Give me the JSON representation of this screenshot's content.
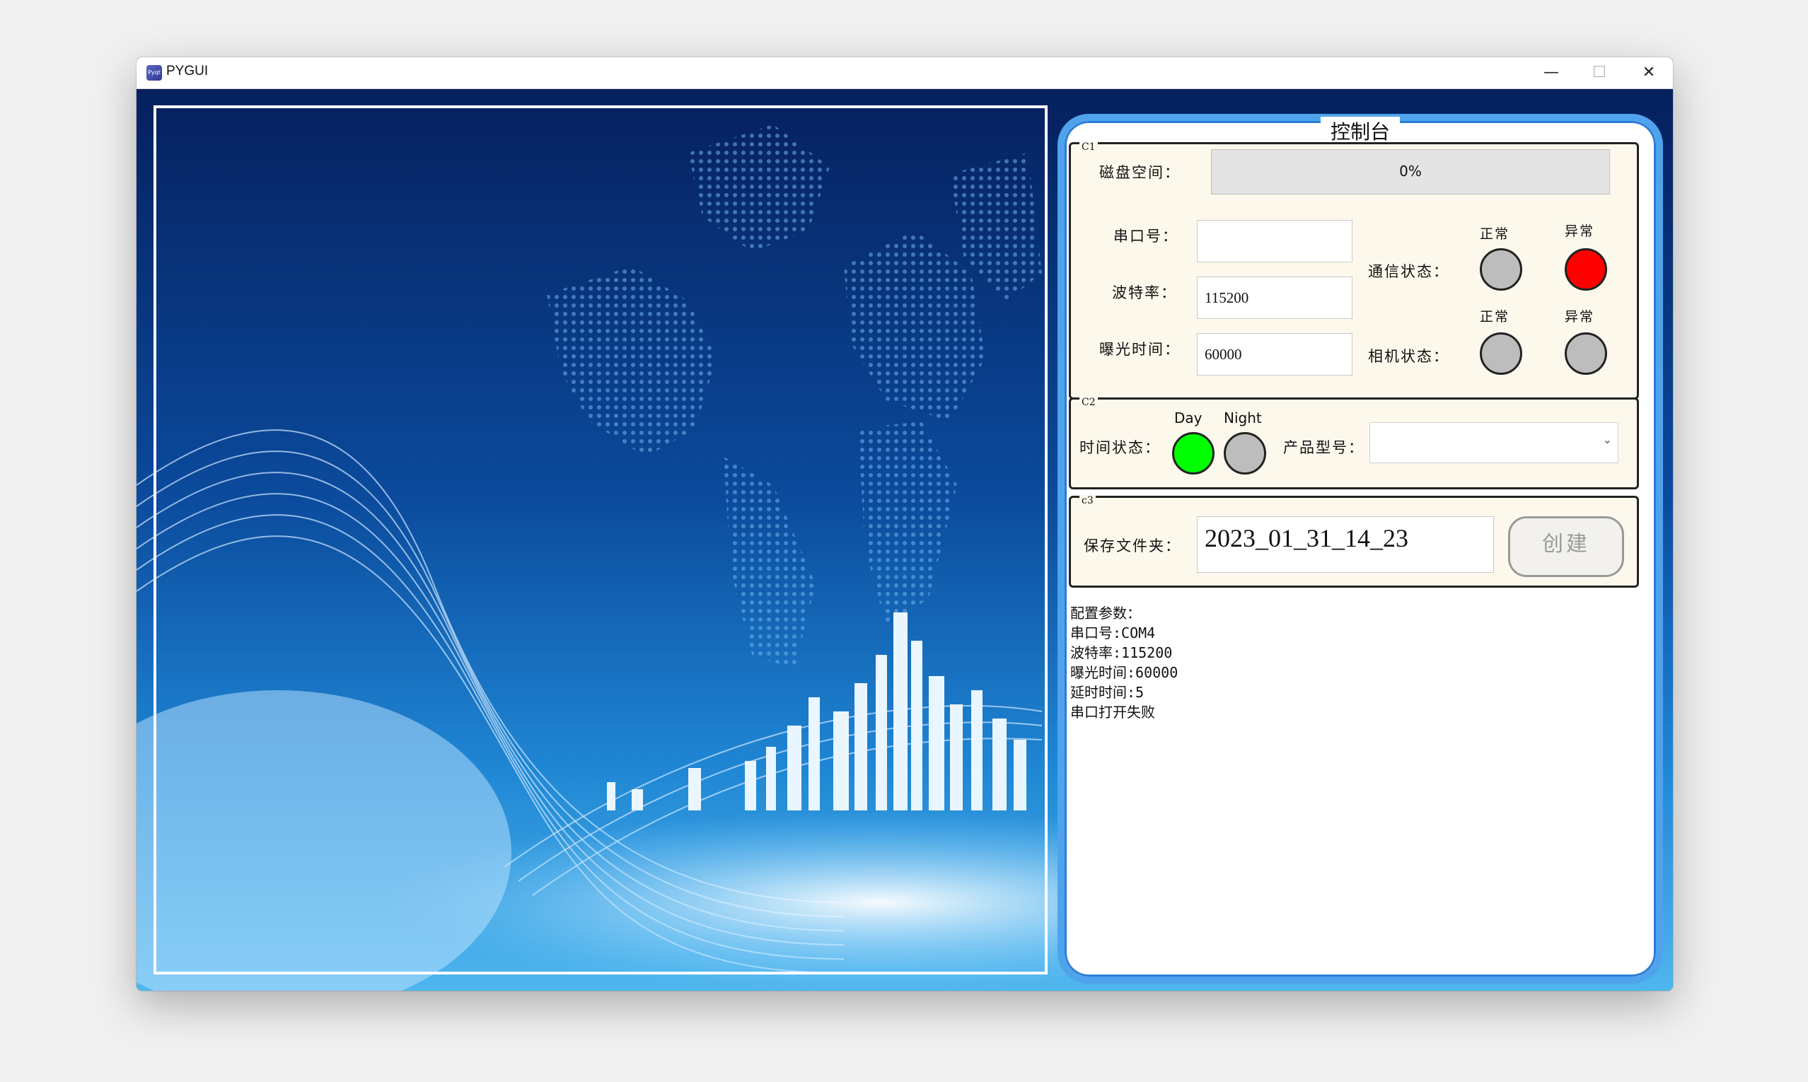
{
  "window": {
    "title": "PYGUI",
    "icon_text": "Pyqt",
    "minimize": "—",
    "maximize": "☐",
    "close": "✕"
  },
  "panel": {
    "title": "控制台",
    "group1": {
      "label": "C1",
      "disk_label": "磁盘空间：",
      "disk_value": "0%",
      "disk_fraction": 0,
      "port_label": "串口号：",
      "port_value": "",
      "baud_label": "波特率：",
      "baud_value": "115200",
      "exposure_label": "曝光时间：",
      "exposure_value": "60000",
      "comm_label": "通信状态：",
      "camera_label": "相机状态：",
      "normal_label": "正常",
      "abnormal_label": "异常",
      "colors": {
        "gray": "#bdbdbd",
        "red": "#ff0000",
        "green": "#00ff00"
      }
    },
    "group2": {
      "label": "C2",
      "time_label": "时间状态：",
      "day_label": "Day",
      "night_label": "Night",
      "product_label": "产品型号：",
      "product_value": ""
    },
    "group3": {
      "label": "c3",
      "save_label": "保存文件夹：",
      "save_value": "2023_01_31_14_23",
      "create_button": "创建"
    },
    "log": [
      "配置参数：",
      "串口号:COM4",
      "波特率:115200",
      "曝光时间:60000",
      "延时时间:5",
      "串口打开失败"
    ]
  }
}
